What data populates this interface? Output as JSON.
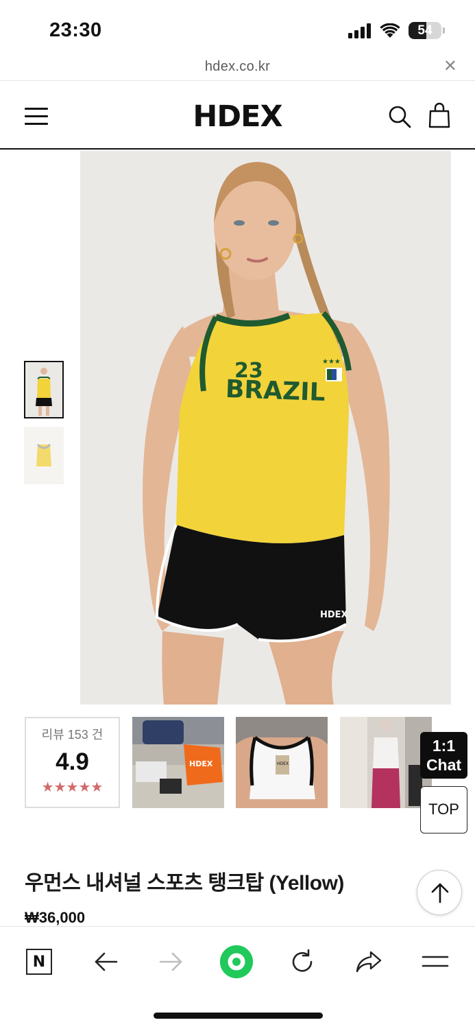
{
  "status_bar": {
    "time": "23:30",
    "battery_level": "54",
    "icons": [
      "signal-icon",
      "wifi-icon",
      "battery-icon"
    ]
  },
  "browser": {
    "url": "hdex.co.kr",
    "close_icon": "close-icon"
  },
  "header": {
    "logo": "HDEX",
    "menu_icon": "hamburger-menu-icon",
    "search_icon": "search-icon",
    "cart_icon": "shopping-bag-icon"
  },
  "product_image": {
    "jersey_number": "23",
    "jersey_text": "BRAZIL",
    "shorts_logo": "HDEX"
  },
  "reviews": {
    "label": "리뷰 153 건",
    "score": "4.9",
    "stars": "★★★★★",
    "photo_logo": "HDEX",
    "photo_tag": "HDEX"
  },
  "floating": {
    "chat_line1": "1:1",
    "chat_line2": "Chat",
    "top_label": "TOP"
  },
  "product": {
    "title": "우먼스 내셔널 스포츠 탱크탑 (Yellow)",
    "price": "₩36,000"
  },
  "toolbar": {
    "n_label": "N",
    "items": [
      "naver-n-icon",
      "back-arrow-icon",
      "forward-arrow-icon",
      "green-dot-icon",
      "reload-icon",
      "share-icon",
      "menu-icon"
    ]
  },
  "colors": {
    "jersey_yellow": "#f2d33a",
    "jersey_green": "#1f5a30",
    "shorts_black": "#111111",
    "chat_bg": "#0d0d0d",
    "star_color": "#d16a6a",
    "green_dot": "#20c95a"
  }
}
